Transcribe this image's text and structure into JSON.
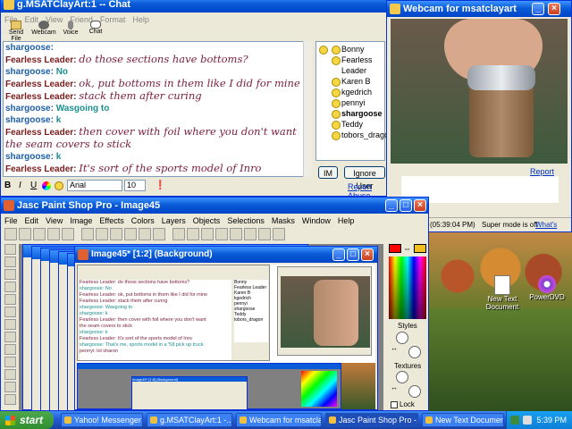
{
  "desktop": {
    "icons": [
      {
        "label": "New Text Document"
      },
      {
        "label": "PowerDVD"
      }
    ]
  },
  "chat_window": {
    "title": "g.MSATClayArt:1 -- Chat",
    "menu": [
      "File",
      "Edit",
      "View",
      "Friend",
      "Format",
      "Help"
    ],
    "toolbar": [
      "Send File",
      "Webcam",
      "Voice",
      "Chat"
    ],
    "messages": [
      {
        "name": "shargoose:",
        "text": "",
        "style": "2"
      },
      {
        "name": "Fearless Leader:",
        "text": "do those sections have bottoms?",
        "style": "1"
      },
      {
        "name": "shargoose:",
        "text": "No",
        "style": "2"
      },
      {
        "name": "Fearless Leader:",
        "text": "ok, put bottoms in them like I did for mine",
        "style": "1"
      },
      {
        "name": "Fearless Leader:",
        "text": "stack them after curing",
        "style": "1"
      },
      {
        "name": "shargoose:",
        "text": "Wasgoing to",
        "style": "2"
      },
      {
        "name": "shargoose:",
        "text": "k",
        "style": "2"
      },
      {
        "name": "Fearless Leader:",
        "text": "then cover with foil where you don't want the seam covers to stick",
        "style": "1"
      },
      {
        "name": "shargoose:",
        "text": "k",
        "style": "2"
      },
      {
        "name": "Fearless Leader:",
        "text": "It's sort of the sports model of Inro",
        "style": "1"
      },
      {
        "name": "shargoose:",
        "text": "That's me, sports model in a '58 pick up truck",
        "style": "2"
      },
      {
        "name": "pennyi:",
        "text": "lol sharon",
        "style": "3"
      }
    ],
    "users": [
      "Bonny",
      "Fearless Leader",
      "Karen B",
      "kgedrich",
      "pennyi",
      "shargoose",
      "Teddy",
      "tobors_dragon"
    ],
    "format_bar": {
      "bold": "B",
      "italic": "I",
      "underline": "U",
      "font": "Arial",
      "size": "10"
    },
    "buttons": {
      "im": "IM",
      "ignore": "Ignore User"
    },
    "report_abuse": "Report Abuse"
  },
  "webcam_window": {
    "title": "Webcam for msatclayart",
    "report_abuse": "Report Abuse",
    "status_time": "(05:39:04 PM)",
    "status_super": "Super mode is off",
    "status_whats": "What's this?"
  },
  "psp_window": {
    "title": "Jasc Paint Shop Pro - Image45",
    "menu": [
      "File",
      "Edit",
      "View",
      "Image",
      "Effects",
      "Colors",
      "Layers",
      "Objects",
      "Selections",
      "Masks",
      "Window",
      "Help"
    ],
    "inner_title": "Image45* [1:2] (Background)",
    "palette_labels": {
      "styles": "Styles",
      "textures": "Textures",
      "lock": "Lock"
    },
    "inner_chat": [
      "Fearless Leader: do those sections have bottoms?",
      "shargoose: No",
      "Fearless Leader: ok, put bottoms in them like I did for mine",
      "Fearless Leader: stack them after curing",
      "shargoose: Wasgoing to",
      "shargoose: k",
      "Fearless Leader: then cover with foil where you don't want",
      "the seam covers to stick",
      "shargoose: k",
      "Fearless Leader: It's sort of the sports model of Inro",
      "shargoose: That's me, sports model in a '58 pick up truck",
      "pennyi: lol sharon"
    ],
    "inner_users": [
      "Bonny",
      "Fearless Leader",
      "Karen B",
      "kgedrich",
      "pennyi",
      "shargoose",
      "Teddy",
      "tobors_dragon"
    ],
    "inner_inner_title": "Image45* [1:8] (Background)"
  },
  "taskbar": {
    "start": "start",
    "tasks": [
      "Yahoo! Messenger (I...",
      "g.MSATClayArt:1 -...",
      "Webcam for msatclay...",
      "Jasc Paint Shop Pro -...",
      "New Text Document ..."
    ],
    "clock": "5:39 PM"
  },
  "colors": {
    "xp_blue": "#0a5bd8",
    "desktop": "#3a6ea5"
  }
}
